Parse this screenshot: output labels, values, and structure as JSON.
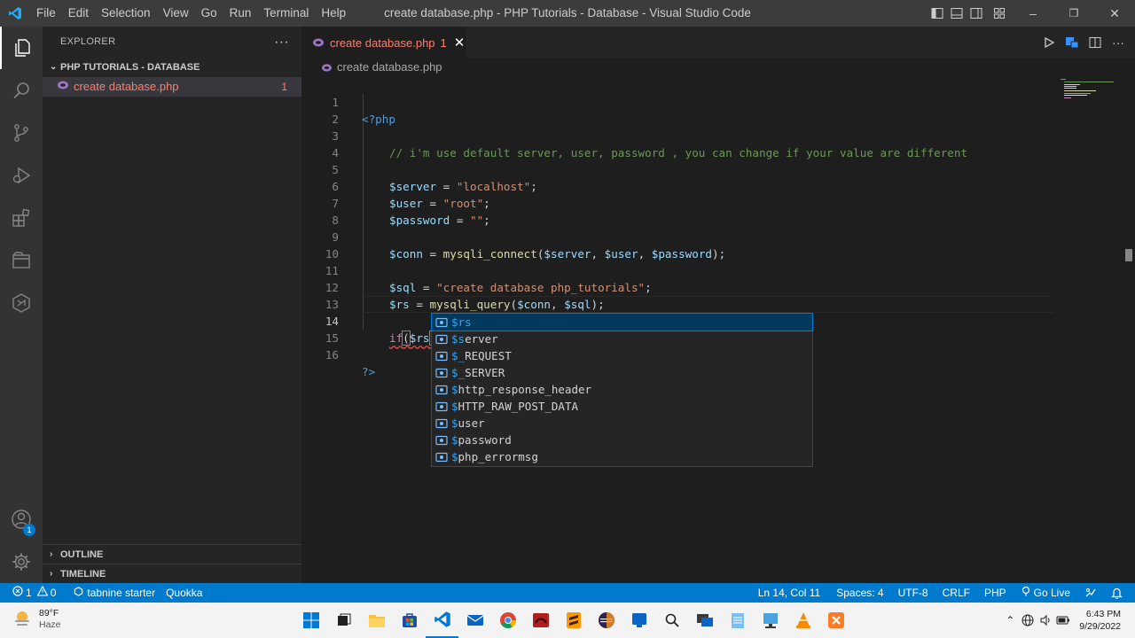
{
  "titlebar": {
    "menu": [
      "File",
      "Edit",
      "Selection",
      "View",
      "Go",
      "Run",
      "Terminal",
      "Help"
    ],
    "window_title": "create database.php - PHP Tutorials - Database - Visual Studio Code",
    "window_buttons": [
      "minimize",
      "restore",
      "close"
    ],
    "minimize_glyph": "–",
    "restore_glyph": "❐",
    "close_glyph": "✕"
  },
  "activity_bar": {
    "items": [
      "explorer",
      "search",
      "source-control",
      "run-and-debug",
      "extensions",
      "remote-explorer",
      "tabnine"
    ],
    "accounts_badge": "1",
    "active": "explorer"
  },
  "sidebar": {
    "title": "EXPLORER",
    "more": "···",
    "folder": "PHP TUTORIALS - DATABASE",
    "files": [
      {
        "name": "create database.php",
        "problems": "1"
      }
    ],
    "sections": [
      "OUTLINE",
      "TIMELINE"
    ]
  },
  "editor": {
    "tab": {
      "label": "create database.php",
      "problems": "1",
      "close": "✕"
    },
    "breadcrumb": "create database.php",
    "cursor_line": 14,
    "line_numbers": [
      "1",
      "2",
      "3",
      "4",
      "5",
      "6",
      "7",
      "8",
      "9",
      "10",
      "11",
      "12",
      "13",
      "14",
      "15",
      "16"
    ],
    "lines": {
      "l1_open": "<?php",
      "l3_comment": "// i'm use default server, user, password , you can change if your value are different",
      "l5_var": "$server",
      "l5_eq": " = ",
      "l5_str": "\"localhost\"",
      "l5_end": ";",
      "l6_var": "$user",
      "l6_eq": " = ",
      "l6_str": "\"root\"",
      "l6_end": ";",
      "l7_var": "$password",
      "l7_eq": " = ",
      "l7_str": "\"\"",
      "l7_end": ";",
      "l9_var": "$conn",
      "l9_eq": " = ",
      "l9_fn": "mysqli_connect",
      "l9_open": "(",
      "l9_a1": "$server",
      "l9_c1": ", ",
      "l9_a2": "$user",
      "l9_c2": ", ",
      "l9_a3": "$password",
      "l9_end": ");",
      "l11_var": "$sql",
      "l11_eq": " = ",
      "l11_str": "\"create database php_tutorials\"",
      "l11_end": ";",
      "l12_var": "$rs",
      "l12_eq": " = ",
      "l12_fn": "mysqli_query",
      "l12_open": "(",
      "l12_a1": "$conn",
      "l12_c1": ", ",
      "l12_a2": "$sql",
      "l12_end": ");",
      "l14_kw": "if",
      "l14_open": "(",
      "l14_var": "$rs",
      "l14_close": ")",
      "l16_close": "?>"
    }
  },
  "suggestions": {
    "selected_index": 0,
    "items": [
      {
        "match": "$rs",
        "rest": ""
      },
      {
        "match": "$s",
        "rest": "erver"
      },
      {
        "match": "$_",
        "rest": "REQUEST"
      },
      {
        "match": "$_",
        "rest": "SERVER"
      },
      {
        "match": "$",
        "rest": "http_response_header"
      },
      {
        "match": "$",
        "rest": "HTTP_RAW_POST_DATA"
      },
      {
        "match": "$",
        "rest": "user"
      },
      {
        "match": "$",
        "rest": "password"
      },
      {
        "match": "$",
        "rest": "php_errormsg"
      }
    ]
  },
  "statusbar": {
    "errors": "1",
    "warnings": "0",
    "tabnine": "tabnine starter",
    "quokka": "Quokka",
    "position": "Ln 14, Col 11",
    "spaces": "Spaces: 4",
    "encoding": "UTF-8",
    "eol": "CRLF",
    "language": "PHP",
    "golive": "Go Live"
  },
  "taskbar": {
    "weather_temp": "89°F",
    "weather_desc": "Haze",
    "time": "6:43 PM",
    "date": "9/29/2022",
    "apps": [
      "start",
      "task-view",
      "file-explorer",
      "store",
      "vscode",
      "mail",
      "chrome",
      "app-red",
      "sublime",
      "eclipse",
      "app-blue",
      "search",
      "remote-desktop",
      "notepad",
      "network-tool",
      "vlc",
      "xampp"
    ]
  },
  "colors": {
    "accent": "#007acc",
    "error": "#f88070",
    "selection": "#04395e"
  }
}
